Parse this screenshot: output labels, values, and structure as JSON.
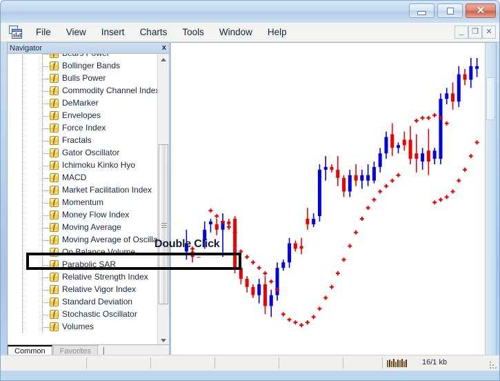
{
  "window": {
    "controls": [
      {
        "name": "minimize",
        "glyph": "minimize-icon"
      },
      {
        "name": "maximize",
        "glyph": "maximize-icon"
      },
      {
        "name": "close",
        "glyph": "close-icon",
        "label": "✕",
        "color": "#c9604c"
      }
    ]
  },
  "menu": {
    "app_icon": "mt4-chart-icon",
    "items": [
      {
        "label": "File"
      },
      {
        "label": "View"
      },
      {
        "label": "Insert"
      },
      {
        "label": "Charts"
      },
      {
        "label": "Tools"
      },
      {
        "label": "Window"
      },
      {
        "label": "Help"
      }
    ],
    "mdi_controls": [
      {
        "name": "mdi-minimize",
        "label": "_"
      },
      {
        "name": "mdi-restore",
        "label": "❐"
      },
      {
        "name": "mdi-close",
        "label": "✕"
      }
    ]
  },
  "navigator": {
    "title": "Navigator",
    "close_label": "x",
    "items": [
      {
        "label": "Bears Power",
        "icon": "function-icon"
      },
      {
        "label": "Bollinger Bands",
        "icon": "function-icon"
      },
      {
        "label": "Bulls Power",
        "icon": "function-icon"
      },
      {
        "label": "Commodity Channel Index",
        "icon": "function-icon"
      },
      {
        "label": "DeMarker",
        "icon": "function-icon"
      },
      {
        "label": "Envelopes",
        "icon": "function-icon"
      },
      {
        "label": "Force Index",
        "icon": "function-icon"
      },
      {
        "label": "Fractals",
        "icon": "function-icon"
      },
      {
        "label": "Gator Oscillator",
        "icon": "function-icon"
      },
      {
        "label": "Ichimoku Kinko Hyo",
        "icon": "function-icon"
      },
      {
        "label": "MACD",
        "icon": "function-icon"
      },
      {
        "label": "Market Facilitation Index",
        "icon": "function-icon"
      },
      {
        "label": "Momentum",
        "icon": "function-icon"
      },
      {
        "label": "Money Flow Index",
        "icon": "function-icon"
      },
      {
        "label": "Moving Average",
        "icon": "function-icon"
      },
      {
        "label": "Moving Average of Oscillat",
        "icon": "function-icon"
      },
      {
        "label": "On Balance Volume",
        "icon": "function-icon",
        "highlighted": true
      },
      {
        "label": "Parabolic SAR",
        "icon": "function-icon"
      },
      {
        "label": "Relative Strength Index",
        "icon": "function-icon"
      },
      {
        "label": "Relative Vigor Index",
        "icon": "function-icon"
      },
      {
        "label": "Standard Deviation",
        "icon": "function-icon"
      },
      {
        "label": "Stochastic Oscillator",
        "icon": "function-icon"
      },
      {
        "label": "Volumes",
        "icon": "function-icon"
      }
    ],
    "tabs": [
      {
        "label": "Common",
        "active": true
      },
      {
        "label": "Favorites",
        "active": false
      }
    ],
    "tab_caret": "|"
  },
  "annotation": {
    "double_click": "Double Click"
  },
  "status_bar": {
    "signal_icon": "connection-strength-icon",
    "traffic": "16/1 kb"
  },
  "chart_data": {
    "type": "candlestick",
    "title": "",
    "xlabel": "",
    "ylabel": "",
    "up_color": "#0000e6",
    "down_color": "#ef0000",
    "sar_color": "#ef0000",
    "indicator": "Parabolic SAR",
    "grid": false,
    "legend": "none",
    "ylim": [
      0,
      100
    ],
    "candles": [
      {
        "o": 28,
        "h": 36,
        "l": 25,
        "c": 31,
        "dir": "up"
      },
      {
        "o": 28,
        "h": 29,
        "l": 24,
        "c": 26,
        "dir": "down"
      },
      {
        "o": 26,
        "h": 26,
        "l": 26,
        "c": 26,
        "dir": "down"
      },
      {
        "o": 32,
        "h": 39,
        "l": 29,
        "c": 36,
        "dir": "up"
      },
      {
        "o": 39,
        "h": 40,
        "l": 35,
        "c": 38,
        "dir": "up"
      },
      {
        "o": 38,
        "h": 40,
        "l": 34,
        "c": 36,
        "dir": "down"
      },
      {
        "o": 36,
        "h": 42,
        "l": 26,
        "c": 39,
        "dir": "up"
      },
      {
        "o": 38,
        "h": 40,
        "l": 36,
        "c": 39,
        "dir": "down"
      },
      {
        "o": 40,
        "h": 41,
        "l": 20,
        "c": 22,
        "dir": "down"
      },
      {
        "o": 22,
        "h": 23,
        "l": 16,
        "c": 18,
        "dir": "down"
      },
      {
        "o": 18,
        "h": 19,
        "l": 13,
        "c": 15,
        "dir": "down"
      },
      {
        "o": 15,
        "h": 16,
        "l": 11,
        "c": 12,
        "dir": "down"
      },
      {
        "o": 12,
        "h": 18,
        "l": 9,
        "c": 16,
        "dir": "up"
      },
      {
        "o": 16,
        "h": 19,
        "l": 5,
        "c": 8,
        "dir": "down"
      },
      {
        "o": 8,
        "h": 14,
        "l": 4,
        "c": 12,
        "dir": "up"
      },
      {
        "o": 12,
        "h": 24,
        "l": 10,
        "c": 22,
        "dir": "up"
      },
      {
        "o": 22,
        "h": 25,
        "l": 21,
        "c": 24,
        "dir": "up"
      },
      {
        "o": 24,
        "h": 33,
        "l": 22,
        "c": 31,
        "dir": "up"
      },
      {
        "o": 31,
        "h": 32,
        "l": 28,
        "c": 29,
        "dir": "down"
      },
      {
        "o": 29,
        "h": 33,
        "l": 27,
        "c": 30,
        "dir": "down"
      },
      {
        "o": 40,
        "h": 44,
        "l": 36,
        "c": 38,
        "dir": "down"
      },
      {
        "o": 38,
        "h": 42,
        "l": 37,
        "c": 40,
        "dir": "up"
      },
      {
        "o": 41,
        "h": 60,
        "l": 39,
        "c": 58,
        "dir": "up"
      },
      {
        "o": 58,
        "h": 63,
        "l": 54,
        "c": 59,
        "dir": "up"
      },
      {
        "o": 59,
        "h": 60,
        "l": 57,
        "c": 58,
        "dir": "down"
      },
      {
        "o": 58,
        "h": 63,
        "l": 52,
        "c": 55,
        "dir": "down"
      },
      {
        "o": 55,
        "h": 56,
        "l": 48,
        "c": 50,
        "dir": "down"
      },
      {
        "o": 50,
        "h": 58,
        "l": 48,
        "c": 56,
        "dir": "up"
      },
      {
        "o": 56,
        "h": 60,
        "l": 52,
        "c": 54,
        "dir": "down"
      },
      {
        "o": 54,
        "h": 58,
        "l": 51,
        "c": 56,
        "dir": "up"
      },
      {
        "o": 56,
        "h": 60,
        "l": 52,
        "c": 54,
        "dir": "up"
      },
      {
        "o": 54,
        "h": 61,
        "l": 53,
        "c": 59,
        "dir": "up"
      },
      {
        "o": 59,
        "h": 66,
        "l": 57,
        "c": 64,
        "dir": "up"
      },
      {
        "o": 64,
        "h": 72,
        "l": 62,
        "c": 70,
        "dir": "up"
      },
      {
        "o": 71,
        "h": 75,
        "l": 63,
        "c": 66,
        "dir": "down"
      },
      {
        "o": 66,
        "h": 68,
        "l": 64,
        "c": 67,
        "dir": "up"
      },
      {
        "o": 67,
        "h": 72,
        "l": 65,
        "c": 69,
        "dir": "down"
      },
      {
        "o": 69,
        "h": 74,
        "l": 60,
        "c": 62,
        "dir": "down"
      },
      {
        "o": 62,
        "h": 71,
        "l": 57,
        "c": 64,
        "dir": "down"
      },
      {
        "o": 64,
        "h": 66,
        "l": 58,
        "c": 61,
        "dir": "up"
      },
      {
        "o": 61,
        "h": 73,
        "l": 56,
        "c": 65,
        "dir": "down"
      },
      {
        "o": 65,
        "h": 66,
        "l": 60,
        "c": 62,
        "dir": "up"
      },
      {
        "o": 62,
        "h": 86,
        "l": 60,
        "c": 84,
        "dir": "up"
      },
      {
        "o": 84,
        "h": 88,
        "l": 82,
        "c": 86,
        "dir": "up"
      },
      {
        "o": 86,
        "h": 90,
        "l": 80,
        "c": 83,
        "dir": "down"
      },
      {
        "o": 83,
        "h": 96,
        "l": 81,
        "c": 93,
        "dir": "up"
      },
      {
        "o": 93,
        "h": 95,
        "l": 89,
        "c": 91,
        "dir": "down"
      },
      {
        "o": 91,
        "h": 99,
        "l": 88,
        "c": 96,
        "dir": "up"
      },
      {
        "o": 96,
        "h": 99,
        "l": 92,
        "c": 95,
        "dir": "up"
      }
    ],
    "sar_points": [
      {
        "i": 1,
        "v": 29
      },
      {
        "i": 4,
        "v": 43
      },
      {
        "i": 5,
        "v": 41
      },
      {
        "i": 6,
        "v": 39
      },
      {
        "i": 7,
        "v": 37
      },
      {
        "i": 8,
        "v": 35
      },
      {
        "i": 9,
        "v": 28
      },
      {
        "i": 10,
        "v": 26
      },
      {
        "i": 11,
        "v": 24
      },
      {
        "i": 12,
        "v": 22
      },
      {
        "i": 13,
        "v": 20
      },
      {
        "i": 14,
        "v": 17
      },
      {
        "i": 15,
        "v": 14
      },
      {
        "i": 16,
        "v": 5
      },
      {
        "i": 17,
        "v": 3
      },
      {
        "i": 18,
        "v": 2
      },
      {
        "i": 19,
        "v": 1
      },
      {
        "i": 20,
        "v": 2
      },
      {
        "i": 21,
        "v": 4
      },
      {
        "i": 22,
        "v": 7
      },
      {
        "i": 23,
        "v": 11
      },
      {
        "i": 24,
        "v": 15
      },
      {
        "i": 25,
        "v": 20
      },
      {
        "i": 26,
        "v": 25
      },
      {
        "i": 27,
        "v": 30
      },
      {
        "i": 28,
        "v": 35
      },
      {
        "i": 29,
        "v": 40
      },
      {
        "i": 30,
        "v": 44
      },
      {
        "i": 31,
        "v": 47
      },
      {
        "i": 32,
        "v": 50
      },
      {
        "i": 33,
        "v": 52
      },
      {
        "i": 34,
        "v": 54
      },
      {
        "i": 35,
        "v": 56
      },
      {
        "i": 38,
        "v": 76
      },
      {
        "i": 39,
        "v": 77
      },
      {
        "i": 40,
        "v": 77
      },
      {
        "i": 41,
        "v": 78
      },
      {
        "i": 42,
        "v": 77
      },
      {
        "i": 43,
        "v": 75
      },
      {
        "i": 41,
        "v": 46
      },
      {
        "i": 42,
        "v": 47
      },
      {
        "i": 43,
        "v": 48
      },
      {
        "i": 44,
        "v": 50
      },
      {
        "i": 45,
        "v": 54
      },
      {
        "i": 46,
        "v": 58
      },
      {
        "i": 47,
        "v": 63
      },
      {
        "i": 48,
        "v": 68
      }
    ]
  }
}
